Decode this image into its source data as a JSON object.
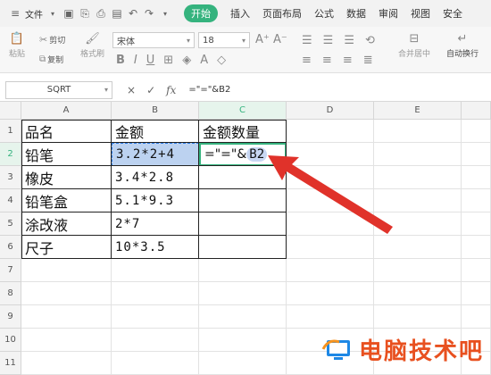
{
  "topbar": {
    "menu_label": "文件",
    "tabs": [
      "开始",
      "插入",
      "页面布局",
      "公式",
      "数据",
      "审阅",
      "视图",
      "安全"
    ],
    "active_tab": "开始"
  },
  "ribbon": {
    "paste": "粘贴",
    "cut": "剪切",
    "copy": "复制",
    "format_painter": "格式刷",
    "font": "宋体",
    "font_size": "18",
    "merge_center": "合并居中",
    "wrap_text": "自动换行"
  },
  "formula_bar": {
    "name_box": "SQRT",
    "cancel_glyph": "×",
    "confirm_glyph": "✓",
    "fx_label": "fx",
    "formula": "=\"=\"&B2"
  },
  "sheet": {
    "columns": [
      "A",
      "B",
      "C",
      "D",
      "E"
    ],
    "rows": [
      "1",
      "2",
      "3",
      "4",
      "5",
      "6",
      "7",
      "8",
      "9",
      "10",
      "11"
    ],
    "header": [
      "品名",
      "金额",
      "金额数量"
    ],
    "data": [
      [
        "铅笔",
        "3.2*2+4"
      ],
      [
        "橡皮",
        "3.4*2.8"
      ],
      [
        "铅笔盒",
        "5.1*9.3"
      ],
      [
        "涂改液",
        "2*7"
      ],
      [
        "尺子",
        "10*3.5"
      ]
    ],
    "edit_prefix": "=\"=\"&",
    "edit_ref": "B2"
  },
  "watermark": {
    "text": "电脑技术吧"
  },
  "colors": {
    "accent": "#35b37e",
    "arrow": "#e0322a",
    "ref_blue": "#2c7be5",
    "watermark": "#e8501f"
  }
}
